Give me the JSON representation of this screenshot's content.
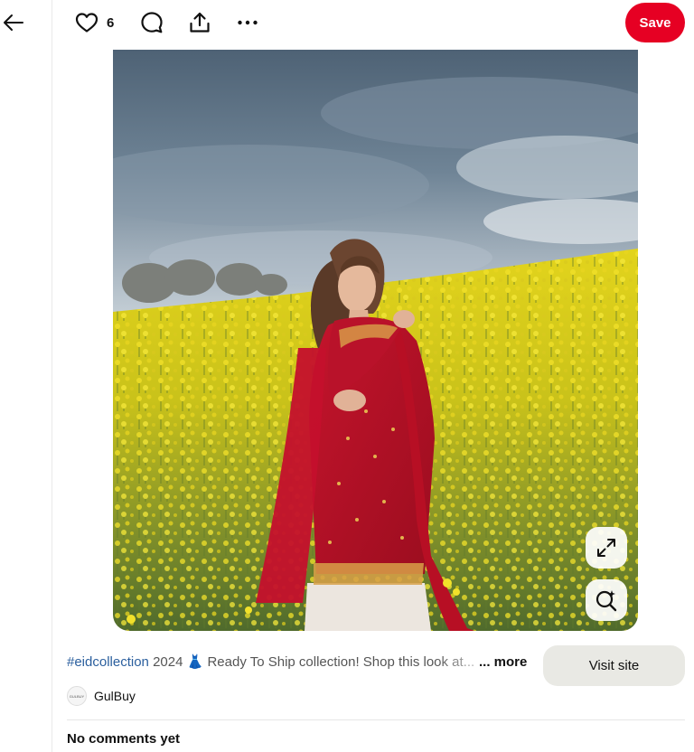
{
  "toolbar": {
    "like_count": "6",
    "save_label": "Save"
  },
  "icons": {
    "back": "arrow-left-icon",
    "like": "heart-icon",
    "comment": "comment-bubble-icon",
    "share": "share-upload-icon",
    "more": "ellipsis-icon",
    "expand": "expand-icon",
    "visual_search": "visual-search-icon"
  },
  "pin": {
    "hashtag": "#eidcollection",
    "description": " 2024 👗 Ready To Ship collection! Shop this look at...",
    "more_label": "... more",
    "visit_label": "Visit site"
  },
  "creator": {
    "avatar_text": "GULBUY",
    "name": "GulBuy"
  },
  "comments": {
    "empty_label": "No comments yet"
  },
  "colors": {
    "save_button": "#e60023",
    "visit_button": "#e9e9e4",
    "hashtag": "#2b5f9e"
  }
}
